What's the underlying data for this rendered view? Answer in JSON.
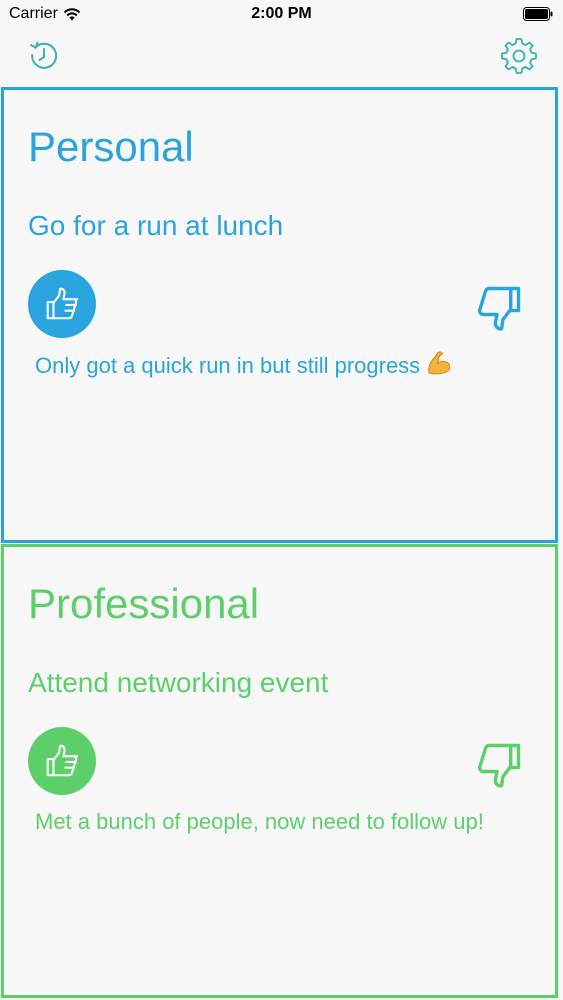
{
  "status_bar": {
    "carrier": "Carrier",
    "time": "2:00 PM"
  },
  "nav_bar": {
    "left_icon": "history-clock-icon",
    "right_icon": "gear-icon",
    "accent_color": "#39b3a6"
  },
  "cards": [
    {
      "title": "Personal",
      "goal": "Go for a run at lunch",
      "note": "Only got a quick run in but still progress",
      "note_emoji": "flexed-biceps-icon",
      "color": "#29a4de",
      "selected": "thumbs-up"
    },
    {
      "title": "Professional",
      "goal": "Attend networking event",
      "note": "Met a bunch of people, now need to follow up!",
      "color": "#5dcf6a",
      "selected": "thumbs-up"
    }
  ]
}
